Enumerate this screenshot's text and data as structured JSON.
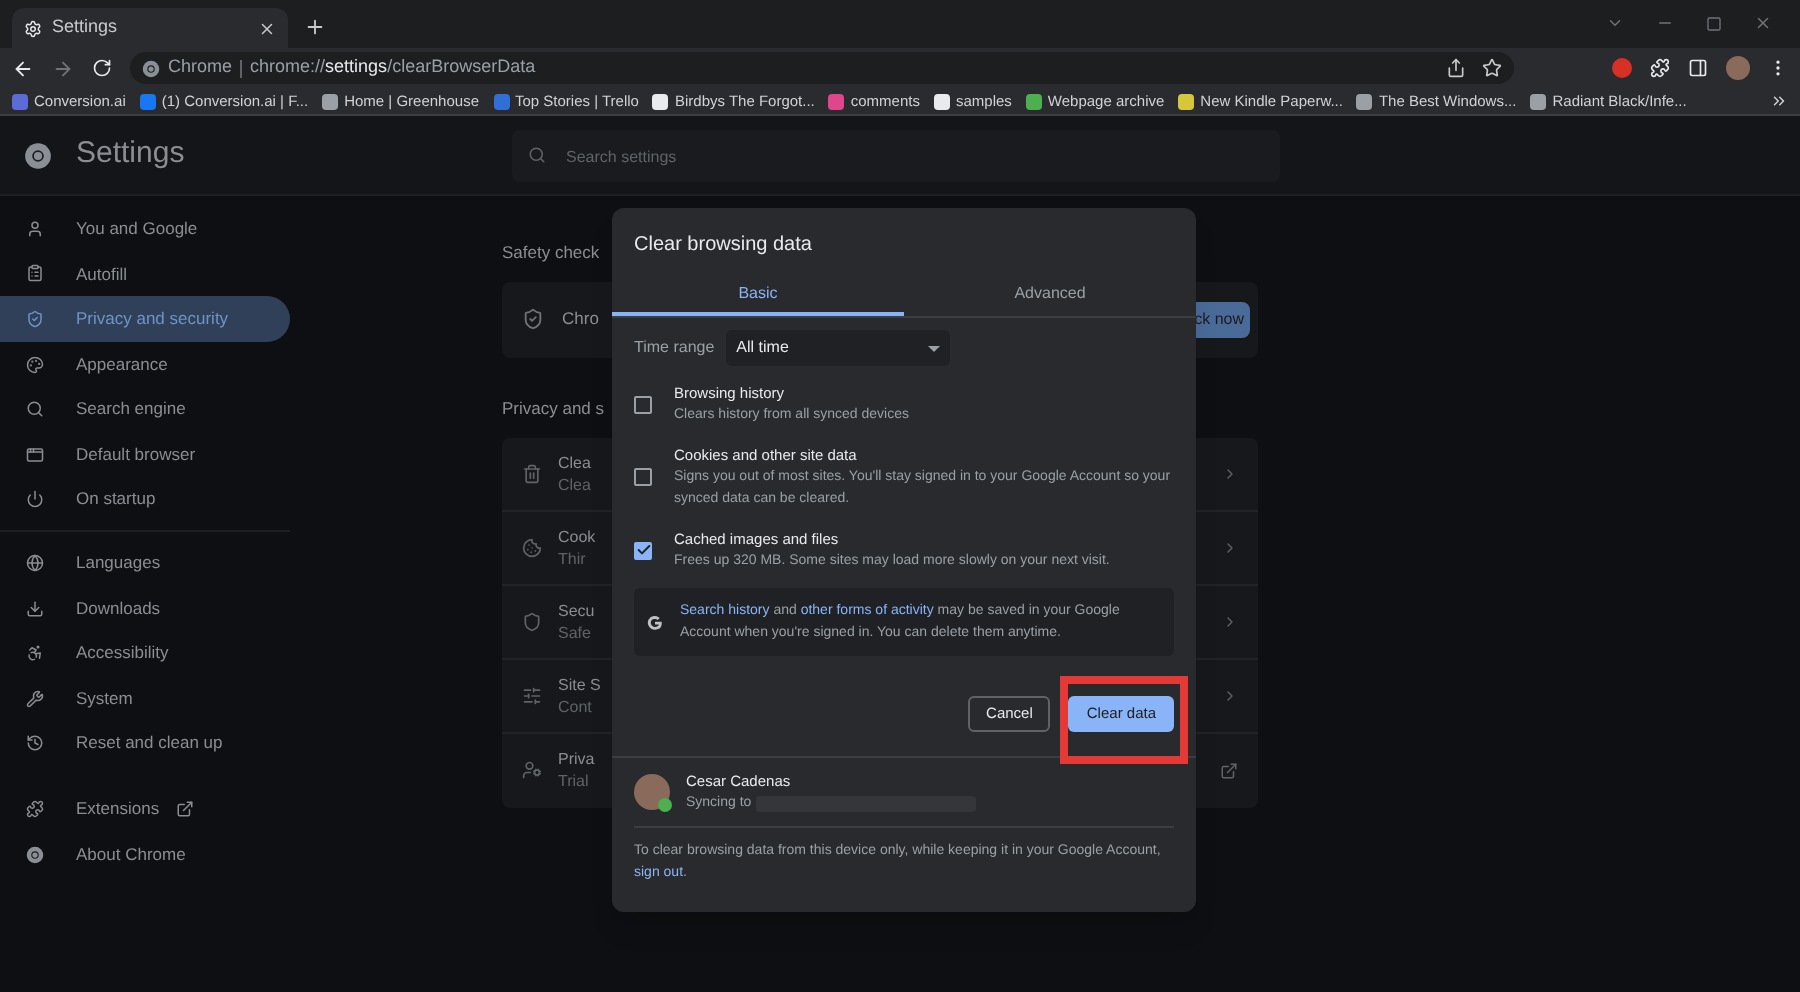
{
  "browser_tab": {
    "title": "Settings"
  },
  "address_bar": {
    "site_label": "Chrome",
    "url": "chrome://**settings**/clearBrowserData"
  },
  "bookmarks": [
    {
      "label": "Conversion.ai"
    },
    {
      "label": "(1) Conversion.ai | F..."
    },
    {
      "label": "Home | Greenhouse"
    },
    {
      "label": "Top Stories | Trello"
    },
    {
      "label": "Birdbys The Forgot..."
    },
    {
      "label": "comments"
    },
    {
      "label": "samples"
    },
    {
      "label": "Webpage archive"
    },
    {
      "label": "New Kindle Paperw..."
    },
    {
      "label": "The Best Windows..."
    },
    {
      "label": "Radiant Black/Infe..."
    }
  ],
  "settings_header": {
    "title": "Settings",
    "search_placeholder": "Search settings"
  },
  "sidebar": {
    "groups": [
      [
        {
          "label": "You and Google",
          "selected": false,
          "external": false
        },
        {
          "label": "Autofill",
          "selected": false,
          "external": false
        },
        {
          "label": "Privacy and security",
          "selected": true,
          "external": false
        },
        {
          "label": "Appearance",
          "selected": false,
          "external": false
        },
        {
          "label": "Search engine",
          "selected": false,
          "external": false
        },
        {
          "label": "Default browser",
          "selected": false,
          "external": false
        },
        {
          "label": "On startup",
          "selected": false,
          "external": false
        }
      ],
      [
        {
          "label": "Languages",
          "selected": false,
          "external": false
        },
        {
          "label": "Downloads",
          "selected": false,
          "external": false
        },
        {
          "label": "Accessibility",
          "selected": false,
          "external": false
        },
        {
          "label": "System",
          "selected": false,
          "external": false
        },
        {
          "label": "Reset and clean up",
          "selected": false,
          "external": false
        }
      ],
      [
        {
          "label": "Extensions",
          "selected": false,
          "external": true
        },
        {
          "label": "About Chrome",
          "selected": false,
          "external": false
        }
      ]
    ]
  },
  "background": {
    "safety_check": {
      "heading": "Safety check",
      "text": "Chro",
      "button": "ck now"
    },
    "privacy": {
      "heading": "Privacy and s",
      "rows": [
        {
          "title": "Clea",
          "subtitle": "Clea",
          "kind": "chevron"
        },
        {
          "title": "Cook",
          "subtitle": "Thir",
          "kind": "chevron"
        },
        {
          "title": "Secu",
          "subtitle": "Safe",
          "kind": "chevron"
        },
        {
          "title": "Site S",
          "subtitle": "Cont",
          "kind": "chevron"
        },
        {
          "title": "Priva",
          "subtitle": "Trial",
          "kind": "external"
        }
      ]
    }
  },
  "dialog": {
    "title": "Clear browsing data",
    "tabs": [
      {
        "label": "Basic",
        "selected": true
      },
      {
        "label": "Advanced",
        "selected": false
      }
    ],
    "time_range": {
      "label": "Time range",
      "value": "All time"
    },
    "options": [
      {
        "title": "Browsing history",
        "description": "Clears history from all synced devices",
        "checked": false
      },
      {
        "title": "Cookies and other site data",
        "description": "Signs you out of most sites. You'll stay signed in to your Google Account so your synced data can be cleared.",
        "checked": false
      },
      {
        "title": "Cached images and files",
        "description": "Frees up 320 MB. Some sites may load more slowly on your next visit.",
        "checked": true
      }
    ],
    "notice": [
      {
        "text": "Search history",
        "link": true
      },
      {
        "text": " and ",
        "link": false
      },
      {
        "text": "other forms of activity",
        "link": true
      },
      {
        "text": " may be saved in your Google Account when you're signed in. You can delete them anytime.",
        "link": false
      }
    ],
    "cancel_button": "Cancel",
    "confirm_button": {
      "label": "Clear data",
      "highlighted": true
    },
    "account": {
      "name": "Cesar Cadenas",
      "status": "Syncing to"
    },
    "footer": [
      {
        "text": "To clear browsing data from this device only, while keeping it in your Google Account, ",
        "link": false
      },
      {
        "text": "sign out",
        "link": true
      },
      {
        "text": ".",
        "link": false
      }
    ]
  }
}
